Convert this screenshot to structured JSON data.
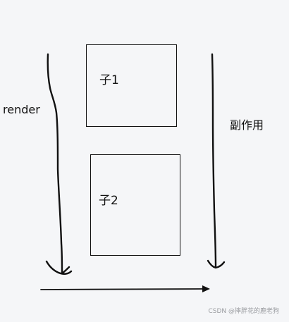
{
  "labels": {
    "left": "render",
    "right": "副作用",
    "child1": "子1",
    "child2": "子2"
  },
  "watermark": "CSDN @摔胖花的鹿老狗",
  "colors": {
    "background": "#f5f6f8",
    "ink": "#111111",
    "watermark": "#9a9ca0"
  }
}
